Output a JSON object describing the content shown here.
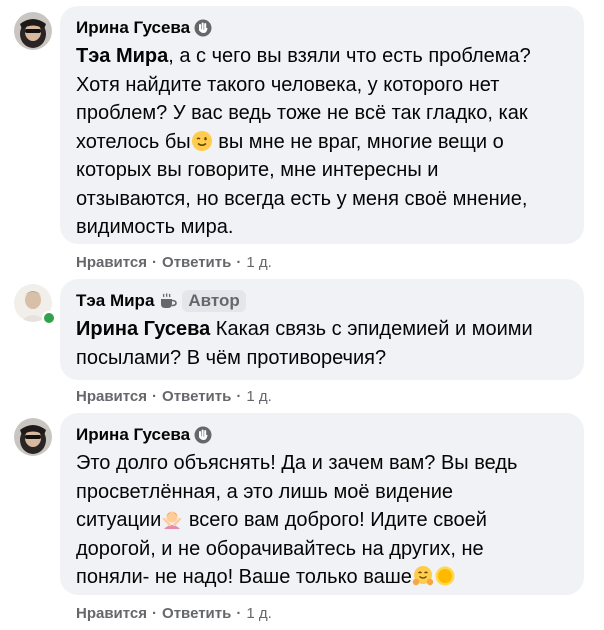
{
  "comments": [
    {
      "author": "Ирина Гусева",
      "mention": "Тэа Мира",
      "line1_rest": ", а с чего вы взяли что есть проблема?",
      "line2": "Хотя найдите такого человека, у которого нет",
      "line3": "проблем? У вас ведь тоже не всё так гладко, как",
      "line4a": "хотелось бы",
      "line4b": " вы мне не враг, многие вещи о",
      "line5": "которых вы говорите, мне интересны и",
      "line6": "отзываются, но всегда есть у меня своё мнение,",
      "line7": "видимость мира.",
      "like": "Нравится",
      "reply": "Ответить",
      "time": "1 д."
    },
    {
      "author": "Тэа Мира",
      "author_tag": "Автор",
      "mention": "Ирина Гусева",
      "line1_rest": " Какая связь с эпидемией и моими",
      "line2": "посылами? В чём противоречия?",
      "like": "Нравится",
      "reply": "Ответить",
      "time": "1 д."
    },
    {
      "author": "Ирина Гусева",
      "line1": "Это долго объяснять! Да и зачем вам? Вы ведь",
      "line2": "просветлённая, а это лишь моё видение",
      "line3a": "ситуации",
      "line3b": " всего вам доброго! Идите своей",
      "line4": "дорогой, и не оборачивайтесь на других, не",
      "line5": "поняли- не надо! Ваше только ваше",
      "like": "Нравится",
      "reply": "Ответить",
      "time": "1 д."
    }
  ],
  "separator": "·",
  "icons": {
    "author_badge": "waving-hand-icon",
    "tea_badge": "coffee-cup-icon",
    "emoji_wink": "winking-face-emoji",
    "emoji_person": "person-gesturing-no-emoji",
    "emoji_hug": "hugging-face-emoji",
    "emoji_sun": "sun-emoji"
  },
  "colors": {
    "bubble": "#f0f2f5",
    "text": "#050505",
    "secondary": "#65676b",
    "online": "#31a24c"
  }
}
